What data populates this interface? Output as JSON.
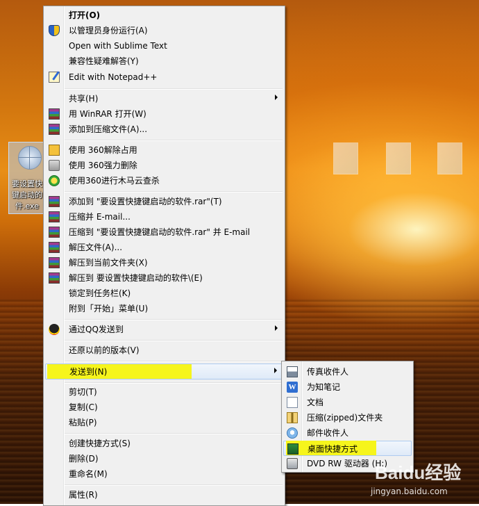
{
  "desktop": {
    "icon_label": "要设置快\n键启动的\n件.exe"
  },
  "main_menu": {
    "items": [
      {
        "label": "打开(O)",
        "icon": null
      },
      {
        "label": "以管理员身份运行(A)",
        "icon": "uac-shield-icon"
      },
      {
        "label": "Open with Sublime Text",
        "icon": null
      },
      {
        "label": "兼容性疑难解答(Y)",
        "icon": null
      },
      {
        "label": "Edit with Notepad++",
        "icon": "notepad-icon"
      },
      {
        "label": "共享(H)",
        "icon": null
      },
      {
        "label": "用 WinRAR 打开(W)",
        "icon": "winrar-icon"
      },
      {
        "label": "添加到压缩文件(A)...",
        "icon": "winrar-icon"
      },
      {
        "label": "使用 360解除占用",
        "icon": "unlock-360-icon"
      },
      {
        "label": "使用 360强力删除",
        "icon": "shredder-360-icon"
      },
      {
        "label": "使用360进行木马云查杀",
        "icon": "scan-360-icon"
      },
      {
        "label": "添加到 \"要设置快捷键启动的软件.rar\"(T)",
        "icon": "winrar-icon"
      },
      {
        "label": "压缩并 E-mail...",
        "icon": "winrar-icon"
      },
      {
        "label": "压缩到 \"要设置快捷键启动的软件.rar\" 并 E-mail",
        "icon": "winrar-icon"
      },
      {
        "label": "解压文件(A)...",
        "icon": "winrar-icon"
      },
      {
        "label": "解压到当前文件夹(X)",
        "icon": "winrar-icon"
      },
      {
        "label": "解压到 要设置快捷键启动的软件\\(E)",
        "icon": "winrar-icon"
      },
      {
        "label": "锁定到任务栏(K)",
        "icon": null
      },
      {
        "label": "附到「开始」菜单(U)",
        "icon": null
      },
      {
        "label": "通过QQ发送到",
        "icon": "qq-icon"
      },
      {
        "label": "还原以前的版本(V)",
        "icon": null
      },
      {
        "label": "发送到(N)",
        "icon": null
      },
      {
        "label": "剪切(T)",
        "icon": null
      },
      {
        "label": "复制(C)",
        "icon": null
      },
      {
        "label": "粘贴(P)",
        "icon": null
      },
      {
        "label": "创建快捷方式(S)",
        "icon": null
      },
      {
        "label": "删除(D)",
        "icon": null
      },
      {
        "label": "重命名(M)",
        "icon": null
      },
      {
        "label": "属性(R)",
        "icon": null
      }
    ]
  },
  "send_to_menu": {
    "items": [
      {
        "label": "传真收件人",
        "icon": "fax-icon"
      },
      {
        "label": "为知笔记",
        "icon": "wiz-note-icon"
      },
      {
        "label": "文档",
        "icon": "document-icon"
      },
      {
        "label": "压缩(zipped)文件夹",
        "icon": "zip-folder-icon"
      },
      {
        "label": "邮件收件人",
        "icon": "mail-recipient-icon"
      },
      {
        "label": "桌面快捷方式",
        "icon": "desktop-shortcut-icon"
      },
      {
        "label": "DVD RW 驱动器 (H:)",
        "icon": "dvd-drive-icon"
      }
    ]
  },
  "watermark": {
    "brand": "Baidu经验",
    "url": "jingyan.baidu.com"
  },
  "colors": {
    "highlight": "#f6f51c",
    "menu_bg": "#f0f0f0"
  }
}
